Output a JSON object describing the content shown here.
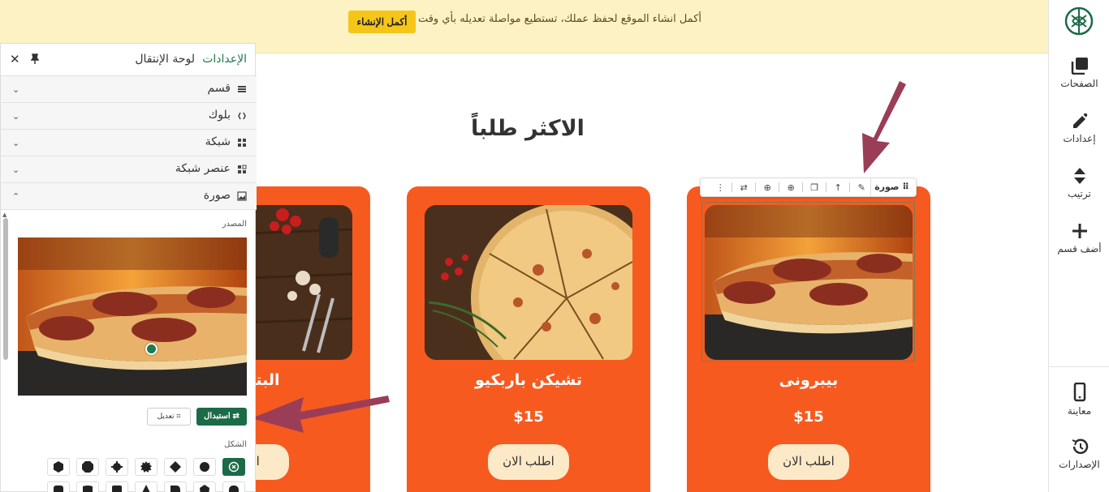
{
  "banner": {
    "message": "أكمل انشاء الموقع لحفظ عملك، تستطيع مواصلة تعديله بأي وقت",
    "cta": "أكمل الإنشاء"
  },
  "right_toolbar": {
    "items": [
      {
        "label": "الصفحات",
        "icon": "pages-icon"
      },
      {
        "label": "إعدادات",
        "icon": "pencil-icon"
      },
      {
        "label": "ترتيب",
        "icon": "sort-icon"
      },
      {
        "label": "أضف قسم",
        "icon": "plus-icon"
      },
      {
        "label": "معاينة",
        "icon": "mobile-icon"
      },
      {
        "label": "الإصدارات",
        "icon": "history-icon"
      }
    ]
  },
  "section": {
    "title": "الاكثر طلباً"
  },
  "cards": [
    {
      "name": "بيبرونى",
      "price": "$15",
      "button": "اطلب الان"
    },
    {
      "name": "تشيكن باربكيو",
      "price": "$15",
      "button": "اطلب الان"
    },
    {
      "name": "البتزا ال",
      "price": "",
      "button": "اطل"
    }
  ],
  "element_toolbar": {
    "label": "صورة"
  },
  "panel": {
    "tabs": {
      "settings": "الإعدادات",
      "navigator": "لوحة الإنتقال"
    },
    "accordion": [
      {
        "label": "قسم",
        "icon": "section-icon",
        "expanded": false
      },
      {
        "label": "بلوك",
        "icon": "block-icon",
        "expanded": false
      },
      {
        "label": "شبكة",
        "icon": "grid-icon",
        "expanded": false
      },
      {
        "label": "عنصر شبكة",
        "icon": "grid-item-icon",
        "expanded": false
      },
      {
        "label": "صورة",
        "icon": "image-icon",
        "expanded": true
      }
    ],
    "source_label": "المصدر",
    "replace_button": "استبدال",
    "edit_button": "تعديل",
    "shape_label": "الشكل",
    "shapes": [
      "none",
      "circle",
      "diamond",
      "badge",
      "gear",
      "octagon",
      "hexagon",
      "rounded-square",
      "tab",
      "leaf",
      "triangle",
      "square-a",
      "square-b",
      "square-c"
    ],
    "selected_shape": "none"
  },
  "colors": {
    "brand_green": "#1b6b48",
    "card_orange": "#f75a1f",
    "banner_yellow": "#fdf2c4",
    "cta_yellow": "#f5c518",
    "arrow_maroon": "#9b3d57"
  }
}
